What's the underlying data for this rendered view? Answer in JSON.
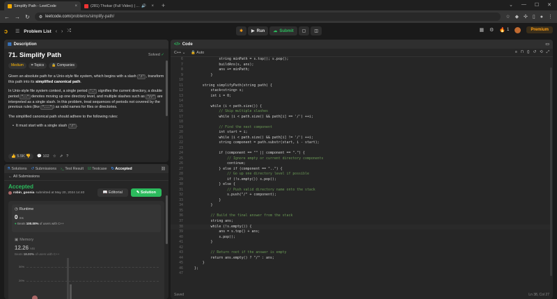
{
  "browser": {
    "tabs": [
      {
        "title": "Simplify Path - LeetCode",
        "active": true
      },
      {
        "title": "(281) Thokar (Full Video) | ...",
        "active": false
      }
    ],
    "url_domain": "leetcode.com",
    "url_path": "/problems/simplify-path/"
  },
  "topbar": {
    "problem_list": "Problem List",
    "run": "Run",
    "submit": "Submit",
    "streak": "1",
    "premium": "Premium"
  },
  "description": {
    "panel_title": "Description",
    "title": "71. Simplify Path",
    "solved": "Solved",
    "tag_difficulty": "Medium",
    "tag_topics": "Topics",
    "tag_companies": "Companies",
    "p1_a": "Given an absolute path for a Unix-style file system, which begins with a slash ",
    "p1_code": "'/'",
    "p1_b": ", transform this path into its ",
    "p1_bold": "simplified canonical path",
    "p1_c": ".",
    "p2_a": "In Unix-style file system context, a single period ",
    "p2_code1": "'.'",
    "p2_b": " signifies the current directory, a double period ",
    "p2_code2": "\"..\"",
    "p2_c": " denotes moving up one directory level, and multiple slashes such as ",
    "p2_code3": "\"//\"",
    "p2_d": " are interpreted as a single slash. In this problem, treat sequences of periods not covered by the previous rules (like ",
    "p2_code4": "\"...\"",
    "p2_e": ") as valid names for files or directories.",
    "p3": "The simplified canonical path should adhere to the following rules:",
    "b1_a": "It must start with a single slash ",
    "b1_code": "'/'",
    "b1_b": ".",
    "likes": "5.5K",
    "comments": "102"
  },
  "submission": {
    "tabs": [
      "Solutions",
      "Submissions",
      "Test Result",
      "Testcase",
      "Accepted"
    ],
    "all_submissions": "All Submissions",
    "status": "Accepted",
    "user": "robin_goonia",
    "submitted": "submitted at May 20, 2024 14:40",
    "editorial": "Editorial",
    "solution": "Solution",
    "runtime_label": "Runtime",
    "runtime_value": "0",
    "runtime_unit": "ms",
    "runtime_beats_label": "Beats",
    "runtime_beats": "100.00%",
    "runtime_beats_suffix": "of users with C++",
    "memory_label": "Memory",
    "memory_value": "12.26",
    "memory_unit": "MB",
    "memory_beats_label": "Beats",
    "memory_beats": "18.00%",
    "memory_beats_suffix": "of users with C++",
    "grid_30": "30%",
    "grid_20": "20%"
  },
  "code": {
    "panel_title": "Code",
    "language": "C++",
    "mode": "Auto",
    "footer_left": "Saved",
    "footer_right": "Ln 38, Col 27",
    "lines": [
      {
        "n": "6",
        "t": "            string minPath = s.top(); s.pop();"
      },
      {
        "n": "7",
        "t": "            buildAns(s, ans);"
      },
      {
        "n": "8",
        "t": "            ans += minPath;"
      },
      {
        "n": "9",
        "t": "        }"
      },
      {
        "n": "10",
        "t": ""
      },
      {
        "n": "11",
        "t": "    string simplifyPath(string path) {"
      },
      {
        "n": "12",
        "t": "        stack<string> s;"
      },
      {
        "n": "13",
        "t": "        int i = 0;"
      },
      {
        "n": "14",
        "t": ""
      },
      {
        "n": "15",
        "t": "        while (i < path.size()) {"
      },
      {
        "n": "16",
        "t": "            // Skip multiple slashes"
      },
      {
        "n": "17",
        "t": "            while (i < path.size() && path[i] == '/') ++i;"
      },
      {
        "n": "18",
        "t": ""
      },
      {
        "n": "19",
        "t": "            // Find the next component"
      },
      {
        "n": "20",
        "t": "            int start = i;"
      },
      {
        "n": "21",
        "t": "            while (i < path.size() && path[i] != '/') ++i;"
      },
      {
        "n": "22",
        "t": "            string component = path.substr(start, i - start);"
      },
      {
        "n": "23",
        "t": ""
      },
      {
        "n": "24",
        "t": "            if (component == \"\" || component == \".\") {"
      },
      {
        "n": "25",
        "t": "                // Ignore empty or current directory components"
      },
      {
        "n": "26",
        "t": "                continue;"
      },
      {
        "n": "27",
        "t": "            } else if (component == \"..\") {"
      },
      {
        "n": "28",
        "t": "                // Go up one directory level if possible"
      },
      {
        "n": "29",
        "t": "                if (!s.empty()) s.pop();"
      },
      {
        "n": "30",
        "t": "            } else {"
      },
      {
        "n": "31",
        "t": "                // Push valid directory name onto the stack"
      },
      {
        "n": "32",
        "t": "                s.push(\"/\" + component);"
      },
      {
        "n": "33",
        "t": "            }"
      },
      {
        "n": "34",
        "t": "        }"
      },
      {
        "n": "35",
        "t": ""
      },
      {
        "n": "36",
        "t": "        // Build the final answer from the stack"
      },
      {
        "n": "37",
        "t": "        string ans;"
      },
      {
        "n": "38",
        "t": "        while (!s.empty()) {"
      },
      {
        "n": "39",
        "t": "            ans = s.top() + ans;"
      },
      {
        "n": "40",
        "t": "            s.pop();"
      },
      {
        "n": "41",
        "t": "        }"
      },
      {
        "n": "42",
        "t": ""
      },
      {
        "n": "43",
        "t": "        // Return root if the answer is empty"
      },
      {
        "n": "44",
        "t": "        return ans.empty() ? \"/\" : ans;"
      },
      {
        "n": "45",
        "t": "    }"
      },
      {
        "n": "46",
        "t": "};"
      },
      {
        "n": "47",
        "t": ""
      }
    ]
  }
}
